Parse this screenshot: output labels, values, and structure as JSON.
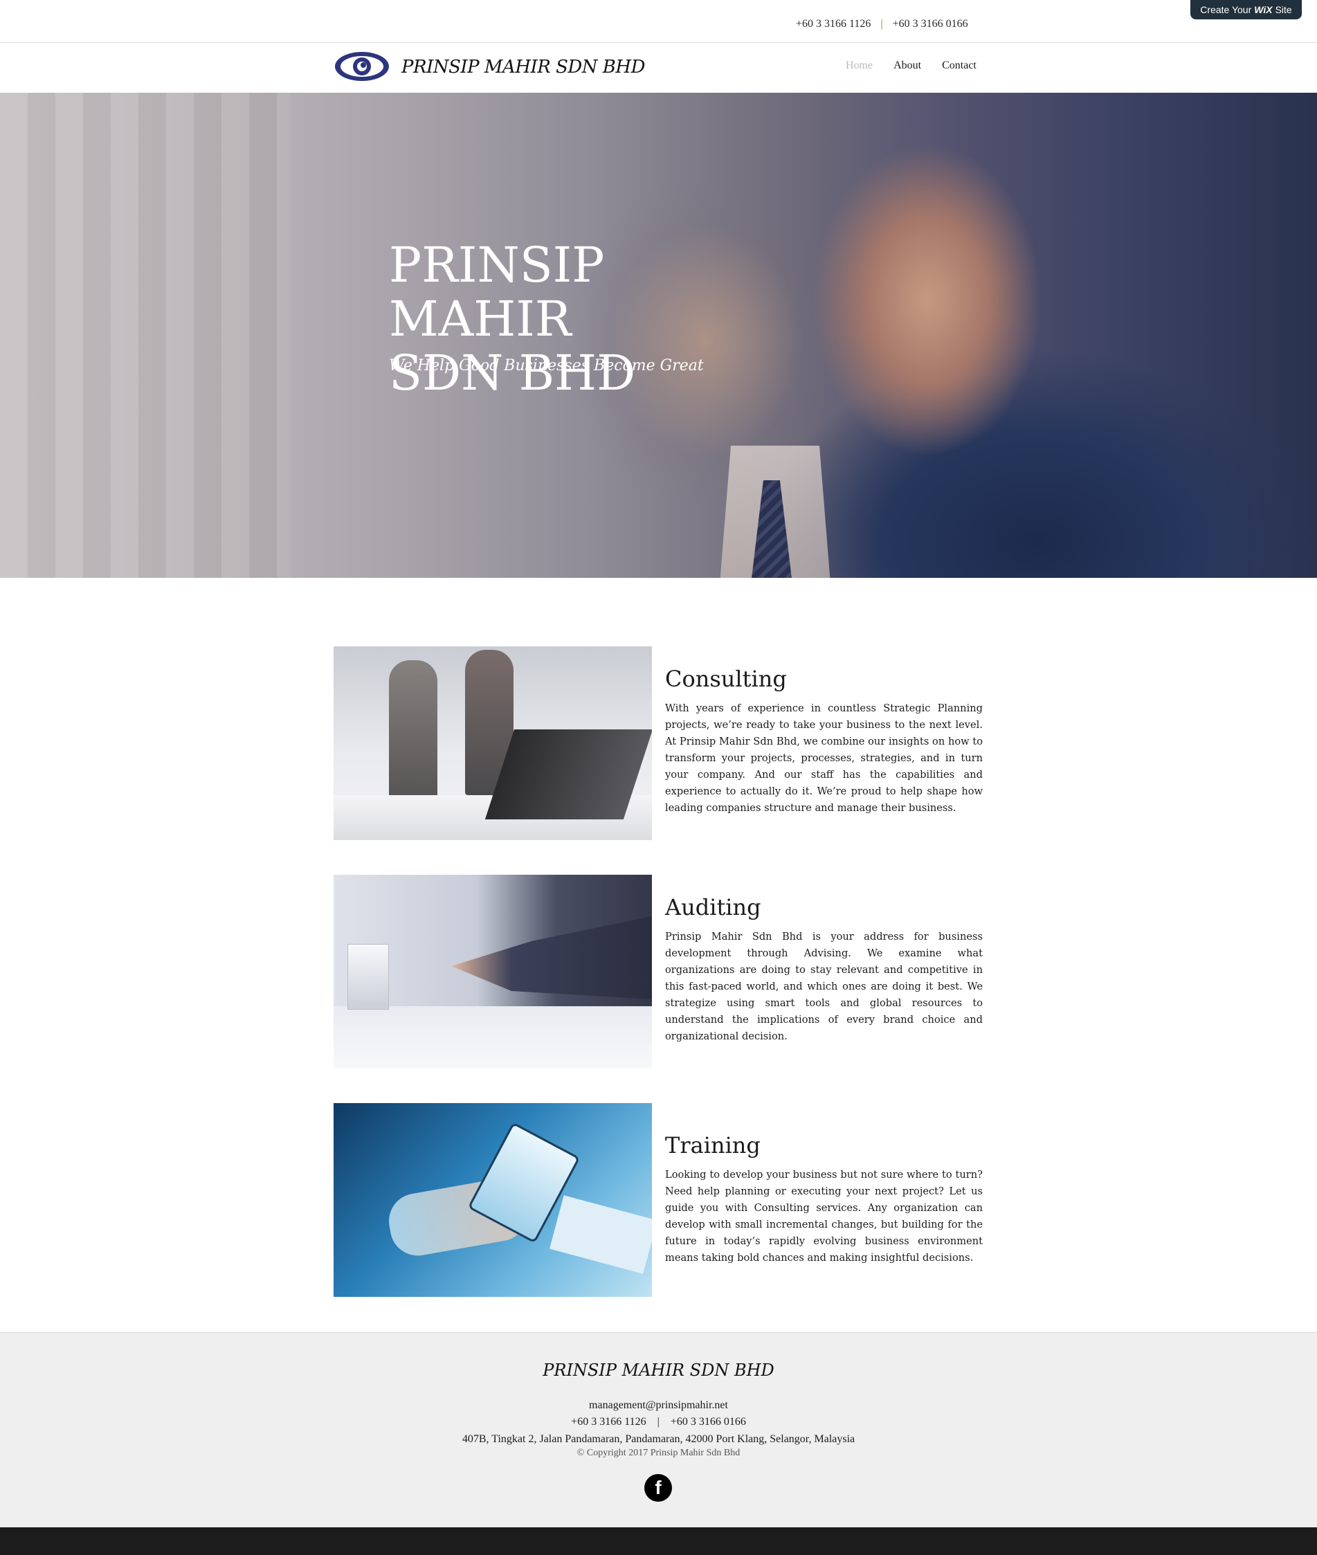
{
  "wix_banner": {
    "prefix": "Create Your",
    "brand": "WiX",
    "suffix": "Site"
  },
  "topbar": {
    "phone1": "+60 3 3166 1126",
    "separator": "|",
    "phone2": "+60 3 3166 0166"
  },
  "header": {
    "brand": "PRINSIP MAHIR SDN BHD",
    "nav": [
      {
        "label": "Home",
        "active": true
      },
      {
        "label": "About",
        "active": false
      },
      {
        "label": "Contact",
        "active": false
      }
    ]
  },
  "hero": {
    "title_line1": "PRINSIP MAHIR",
    "title_line2": "SDN BHD",
    "subtitle": "We Help Good Businesses Become Great"
  },
  "services": [
    {
      "title": "Consulting",
      "text": "With years of experience in countless Strategic Planning projects, we’re ready to take your business to the next level. At Prinsip Mahir Sdn Bhd, we combine our insights on how to transform your projects, processes, strategies, and in turn your company. And our staff has the capabilities and experience to actually do it. We’re proud to help shape how leading companies structure and manage their business."
    },
    {
      "title": "Auditing",
      "text": "Prinsip Mahir Sdn Bhd is your address for business development through Advising. We examine what organizations are doing to stay relevant and competitive in this fast-paced world, and which ones are doing it best. We strategize using smart tools and global resources to understand the implications of every brand choice and organizational decision."
    },
    {
      "title": "Training",
      "text": "Looking to develop your business but not sure where to turn? Need help planning or executing your next project? Let us guide you with Consulting services. Any organization can develop with small incremental changes, but building for the future in today’s rapidly evolving business environment means taking bold chances and making insightful decisions."
    }
  ],
  "footer": {
    "brand": "PRINSIP MAHIR SDN BHD",
    "email": "management@prinsipmahir.net",
    "phones": "+60 3 3166 1126    |    +60 3 3166 0166",
    "address": "407B, Tingkat 2, Jalan Pandamaran, Pandamaran, 42000 Port Klang, Selangor, Malaysia",
    "copyright": "© Copyright 2017 Prinsip Mahir Sdn Bhd",
    "social_icon": "facebook-icon"
  },
  "colors": {
    "logo": "#2d3580",
    "footer_bg": "#efefef",
    "banner_bg": "#20303c"
  }
}
